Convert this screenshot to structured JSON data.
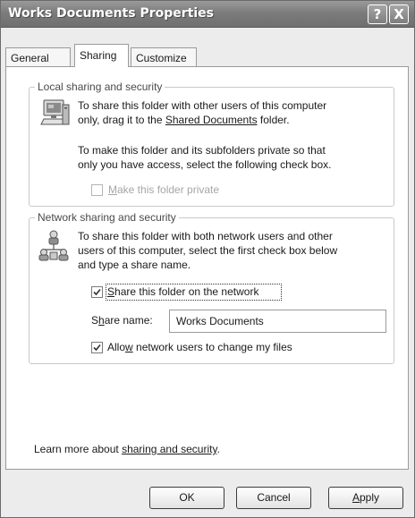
{
  "window": {
    "title": "Works Documents Properties",
    "help_glyph": "?",
    "close_glyph": "X"
  },
  "tabs": [
    {
      "label": "General",
      "selected": false
    },
    {
      "label": "Sharing",
      "selected": true
    },
    {
      "label": "Customize",
      "selected": false
    }
  ],
  "local": {
    "title": "Local sharing and security",
    "line1": "To share this folder with other users of this computer",
    "line2_pre": "only, drag it to the ",
    "line2_link": "Shared Documents",
    "line2_post": " folder.",
    "line3": "To make this folder and its subfolders private so that",
    "line4": "only you have access, select the following check box.",
    "private_checkbox": {
      "label_mnemonic": "M",
      "label_rest": "ake this folder private",
      "checked": false,
      "enabled": false
    }
  },
  "network": {
    "title": "Network sharing and security",
    "line1": "To share this folder with both network users and other",
    "line2": "users of this computer, select the first check box below",
    "line3": "and type a share name.",
    "share_checkbox": {
      "label_mnemonic": "S",
      "label_rest": "hare this folder on the network",
      "checked": true
    },
    "share_name": {
      "label_pre": "S",
      "label_mnemonic": "h",
      "label_post": "are name:",
      "value": "Works Documents"
    },
    "allow_checkbox": {
      "label_pre": "Allo",
      "label_mnemonic": "w",
      "label_post": " network users to change my files",
      "checked": true
    }
  },
  "footer": {
    "learn_pre": "Learn more about ",
    "learn_link": "sharing and security",
    "learn_post": "."
  },
  "buttons": {
    "ok": "OK",
    "cancel": "Cancel",
    "apply_mnemonic": "A",
    "apply_rest": "pply"
  },
  "colors": {
    "titlebar": "#7c7c7c",
    "dialog_bg": "#ececec",
    "panel_bg": "#ffffff",
    "disabled_text": "#a6a6a6",
    "group_title": "#4a4a4a"
  },
  "icons": {
    "local": "computer-icon",
    "network": "network-users-icon",
    "check": "checkmark-icon"
  }
}
